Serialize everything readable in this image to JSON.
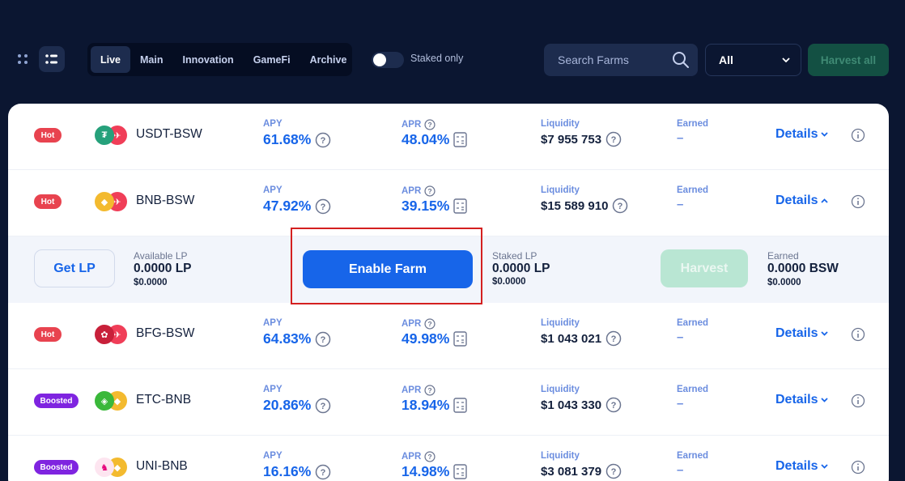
{
  "toolbar": {
    "tabs": [
      {
        "label": "Live",
        "active": true
      },
      {
        "label": "Main",
        "active": false
      },
      {
        "label": "Innovation",
        "active": false
      },
      {
        "label": "GameFi",
        "active": false
      },
      {
        "label": "Archive",
        "active": false
      }
    ],
    "staked_only_label": "Staked only",
    "staked_only_on": false,
    "search_placeholder": "Search Farms",
    "filter_selected": "All",
    "harvest_all_label": "Harvest all"
  },
  "labels": {
    "apy": "APY",
    "apr": "APR",
    "liquidity": "Liquidity",
    "earned": "Earned",
    "details": "Details"
  },
  "farms": [
    {
      "badge": "Hot",
      "pair": "USDT-BSW",
      "apy": "61.68%",
      "apr": "48.04%",
      "liquidity": "$7 955 753",
      "earned": "–",
      "expanded": false
    },
    {
      "badge": "Hot",
      "pair": "BNB-BSW",
      "apy": "47.92%",
      "apr": "39.15%",
      "liquidity": "$15 589 910",
      "earned": "–",
      "expanded": true
    },
    {
      "badge": "Hot",
      "pair": "BFG-BSW",
      "apy": "64.83%",
      "apr": "49.98%",
      "liquidity": "$1 043 021",
      "earned": "–",
      "expanded": false
    },
    {
      "badge": "Boosted",
      "pair": "ETC-BNB",
      "apy": "20.86%",
      "apr": "18.94%",
      "liquidity": "$1 043 330",
      "earned": "–",
      "expanded": false
    },
    {
      "badge": "Boosted",
      "pair": "UNI-BNB",
      "apy": "16.16%",
      "apr": "14.98%",
      "liquidity": "$3 081 379",
      "earned": "–",
      "expanded": false
    }
  ],
  "expanded": {
    "get_lp_label": "Get LP",
    "available_lp_label": "Available LP",
    "available_lp_value": "0.0000 LP",
    "available_lp_usd": "$0.0000",
    "enable_farm_label": "Enable Farm",
    "staked_lp_label": "Staked LP",
    "staked_lp_value": "0.0000 LP",
    "staked_lp_usd": "$0.0000",
    "harvest_label": "Harvest",
    "earned_label": "Earned",
    "earned_value": "0.0000 BSW",
    "earned_usd": "$0.0000"
  },
  "colors": {
    "background": "#0b1631",
    "accent": "#1765e9",
    "hot_badge": "#e8434f",
    "boosted_badge": "#7f24e0",
    "harvest_all": "#135043",
    "highlight_box": "#d42020"
  }
}
